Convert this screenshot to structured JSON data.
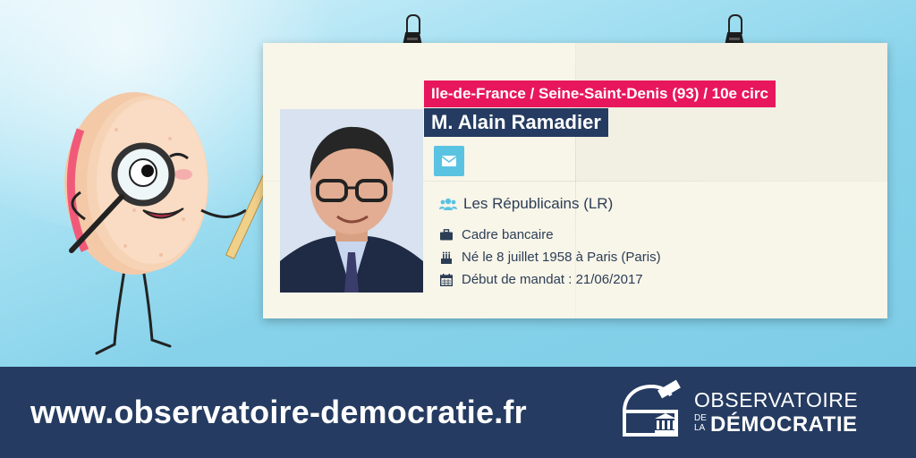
{
  "card": {
    "region": "Ile-de-France / Seine-Saint-Denis (93) / 10e circ",
    "name": "M. Alain Ramadier",
    "party": "Les Républicains (LR)",
    "profession": "Cadre bancaire",
    "birth": "Né le 8 juillet 1958 à Paris (Paris)",
    "mandate_start": "Début de mandat : 21/06/2017"
  },
  "icons": {
    "contact": "envelope-icon",
    "party": "users-icon",
    "profession": "briefcase-icon",
    "birth": "birthday-cake-icon",
    "mandate": "calendar-icon"
  },
  "footer": {
    "url": "www.observatoire-democratie.fr",
    "logo_line1": "OBSERVATOIRE",
    "logo_de": "DE",
    "logo_la": "LA",
    "logo_line2": "DÉMOCRATIE"
  },
  "colors": {
    "region_bg": "#e8175d",
    "name_bg": "#253b61",
    "mail_button": "#5bc3e2",
    "footer_bg": "#253b61",
    "background": "#87d3ec"
  }
}
